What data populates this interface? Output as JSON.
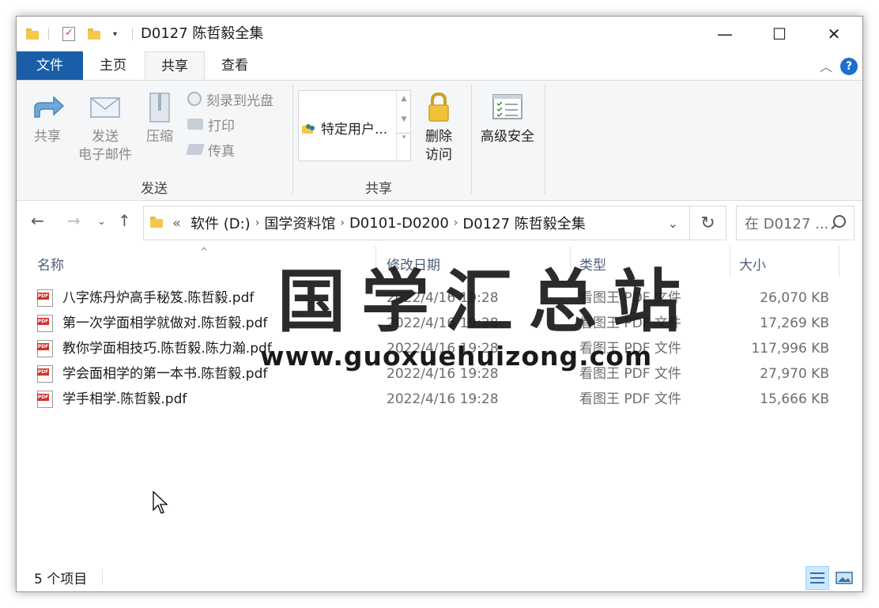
{
  "window": {
    "title": "D0127 陈哲毅全集",
    "minimize": "—",
    "maximize": "☐",
    "close": "✕"
  },
  "ribbon_tabs": [
    {
      "label": "文件"
    },
    {
      "label": "主页"
    },
    {
      "label": "共享"
    },
    {
      "label": "查看"
    }
  ],
  "ribbon": {
    "share": "共享",
    "email_line1": "发送",
    "email_line2": "电子邮件",
    "zip": "压缩",
    "burn": "刻录到光盘",
    "print": "打印",
    "fax": "传真",
    "group_send": "发送",
    "specific_users": "特定用户...",
    "remove_access_line1": "删除",
    "remove_access_line2": "访问",
    "group_share": "共享",
    "advanced_security": "高级安全"
  },
  "address": {
    "overflow": "«",
    "crumbs": [
      "软件 (D:)",
      "国学资料馆",
      "D0101-D0200",
      "D0127 陈哲毅全集"
    ],
    "search_placeholder": "在 D0127 ..."
  },
  "columns": {
    "name": "名称",
    "modified": "修改日期",
    "type": "类型",
    "size": "大小"
  },
  "files": [
    {
      "name": "八字炼丹炉高手秘笈.陈哲毅.pdf",
      "modified": "2022/4/16 19:28",
      "type": "看图王 PDF 文件",
      "size": "26,070 KB"
    },
    {
      "name": "第一次学面相学就做对.陈哲毅.pdf",
      "modified": "2022/4/16 19:28",
      "type": "看图王 PDF 文件",
      "size": "17,269 KB"
    },
    {
      "name": "教你学面相技巧.陈哲毅.陈力瀚.pdf",
      "modified": "2022/4/16 19:28",
      "type": "看图王 PDF 文件",
      "size": "117,996 KB"
    },
    {
      "name": "学会面相学的第一本书.陈哲毅.pdf",
      "modified": "2022/4/16 19:28",
      "type": "看图王 PDF 文件",
      "size": "27,970 KB"
    },
    {
      "name": "学手相学.陈哲毅.pdf",
      "modified": "2022/4/16 19:28",
      "type": "看图王 PDF 文件",
      "size": "15,666 KB"
    }
  ],
  "watermark": {
    "title": "国学汇总站",
    "url": "www.guoxuehuizong.com"
  },
  "status": {
    "item_count": "5 个项目"
  },
  "colors": {
    "file_tab": "#1a5ea8",
    "help": "#1c6fcf",
    "header_text": "#4c607a",
    "folder": "#f5c74b"
  }
}
